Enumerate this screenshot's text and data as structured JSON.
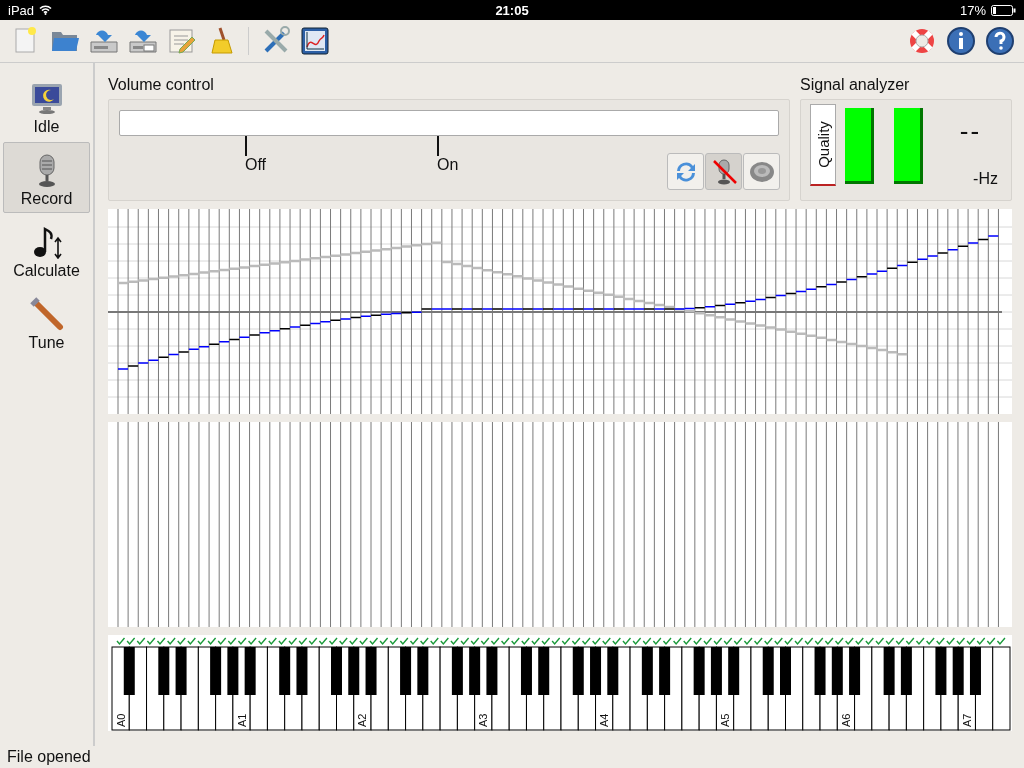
{
  "status_bar": {
    "device": "iPad",
    "time": "21:05",
    "battery": "17%"
  },
  "sidebar": {
    "items": [
      {
        "label": "Idle",
        "kind": "idle",
        "selected": false
      },
      {
        "label": "Record",
        "kind": "record",
        "selected": true
      },
      {
        "label": "Calculate",
        "kind": "calculate",
        "selected": false
      },
      {
        "label": "Tune",
        "kind": "tune",
        "selected": false
      }
    ]
  },
  "volume_control": {
    "title": "Volume control",
    "markers": [
      {
        "label": "Off"
      },
      {
        "label": "On"
      }
    ],
    "buttons": [
      {
        "kind": "refresh",
        "pressed": false
      },
      {
        "kind": "mute",
        "pressed": true
      },
      {
        "kind": "speaker",
        "pressed": false
      }
    ]
  },
  "signal_analyzer": {
    "title": "Signal analyzer",
    "quality_label": "Quality",
    "bars": [
      {
        "level": 1
      },
      {
        "level": 1
      }
    ],
    "frequency": "--",
    "unit": "-Hz"
  },
  "keyboard": {
    "labels": [
      "A0",
      "A1",
      "A2",
      "A3",
      "A4",
      "A5",
      "A6",
      "A7"
    ]
  },
  "footer": {
    "message": "File opened"
  }
}
